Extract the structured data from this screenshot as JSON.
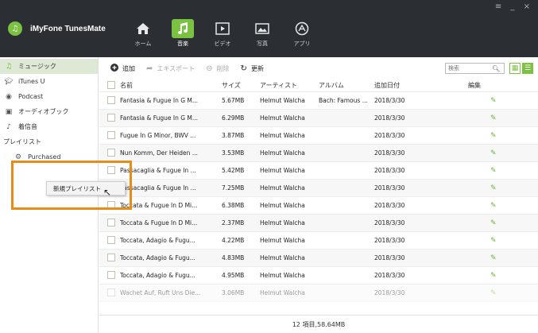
{
  "window": {
    "controls": "≡ _ ×"
  },
  "app": {
    "name": "iMyFone TunesMate"
  },
  "top_nav": [
    {
      "label": "ホーム",
      "icon": "home-icon"
    },
    {
      "label": "音楽",
      "icon": "music-icon",
      "active": true
    },
    {
      "label": "ビデオ",
      "icon": "video-icon"
    },
    {
      "label": "写真",
      "icon": "photo-icon"
    },
    {
      "label": "アプリ",
      "icon": "apps-icon"
    }
  ],
  "sidebar": {
    "items": [
      {
        "label": "ミュージック",
        "icon": "music-note-icon",
        "active": true
      },
      {
        "label": "iTunes U",
        "icon": "graduation-cap-icon"
      },
      {
        "label": "Podcast",
        "icon": "podcast-icon"
      },
      {
        "label": "オーディオブック",
        "icon": "audiobook-icon"
      },
      {
        "label": "着信音",
        "icon": "bell-icon"
      }
    ],
    "playlist_heading": "プレイリスト",
    "playlists": [
      {
        "label": "Purchased",
        "icon": "gear-icon"
      }
    ]
  },
  "context_menu": {
    "item": "新規プレイリスト"
  },
  "toolbar": {
    "add": "追加",
    "export": "エキスポート",
    "delete": "削除",
    "refresh": "更新",
    "search_placeholder": "検索"
  },
  "table": {
    "headers": {
      "name": "名前",
      "size": "サイズ",
      "artist": "アーティスト",
      "album": "アルバム",
      "date": "追加日付",
      "edit": "編集"
    },
    "rows": [
      {
        "name": "Fantasia & Fugue In G M...",
        "size": "5.67MB",
        "artist": "Helmut Walcha",
        "album": "Bach: Famous ...",
        "date": "2018/3/30"
      },
      {
        "name": "Fantasia & Fugue In G M...",
        "size": "6.29MB",
        "artist": "Helmut Walcha",
        "album": "",
        "date": "2018/3/30"
      },
      {
        "name": "Fugue In G Minor, BWV ...",
        "size": "3.87MB",
        "artist": "Helmut Walcha",
        "album": "",
        "date": "2018/3/30"
      },
      {
        "name": "Nun Komm, Der Heiden ...",
        "size": "3.53MB",
        "artist": "Helmut Walcha",
        "album": "",
        "date": "2018/3/30"
      },
      {
        "name": "Passacaglia & Fugue In ...",
        "size": "5.42MB",
        "artist": "Helmut Walcha",
        "album": "",
        "date": "2018/3/30"
      },
      {
        "name": "Passacaglia & Fugue In ...",
        "size": "7.25MB",
        "artist": "Helmut Walcha",
        "album": "",
        "date": "2018/3/30"
      },
      {
        "name": "Toccata & Fugue In D Mi...",
        "size": "6.38MB",
        "artist": "Helmut Walcha",
        "album": "",
        "date": "2018/3/30"
      },
      {
        "name": "Toccata & Fugue In D Mi...",
        "size": "2.37MB",
        "artist": "Helmut Walcha",
        "album": "",
        "date": "2018/3/30"
      },
      {
        "name": "Toccata, Adagio & Fugu...",
        "size": "4.22MB",
        "artist": "Helmut Walcha",
        "album": "",
        "date": "2018/3/30"
      },
      {
        "name": "Toccata, Adagio & Fugu...",
        "size": "4.83MB",
        "artist": "Helmut Walcha",
        "album": "",
        "date": "2018/3/30"
      },
      {
        "name": "Toccata, Adagio & Fugu...",
        "size": "4.95MB",
        "artist": "Helmut Walcha",
        "album": "",
        "date": "2018/3/30"
      },
      {
        "name": "Wachet Auf, Ruft Uns Die...",
        "size": "3.06MB",
        "artist": "Helmut Walcha",
        "album": "",
        "date": "2018/3/30"
      }
    ]
  },
  "footer": {
    "summary": "12 項目,58.64MB"
  },
  "colors": {
    "accent": "#7cc242",
    "titlebar": "#2b2f33",
    "highlight": "#e98b18"
  }
}
